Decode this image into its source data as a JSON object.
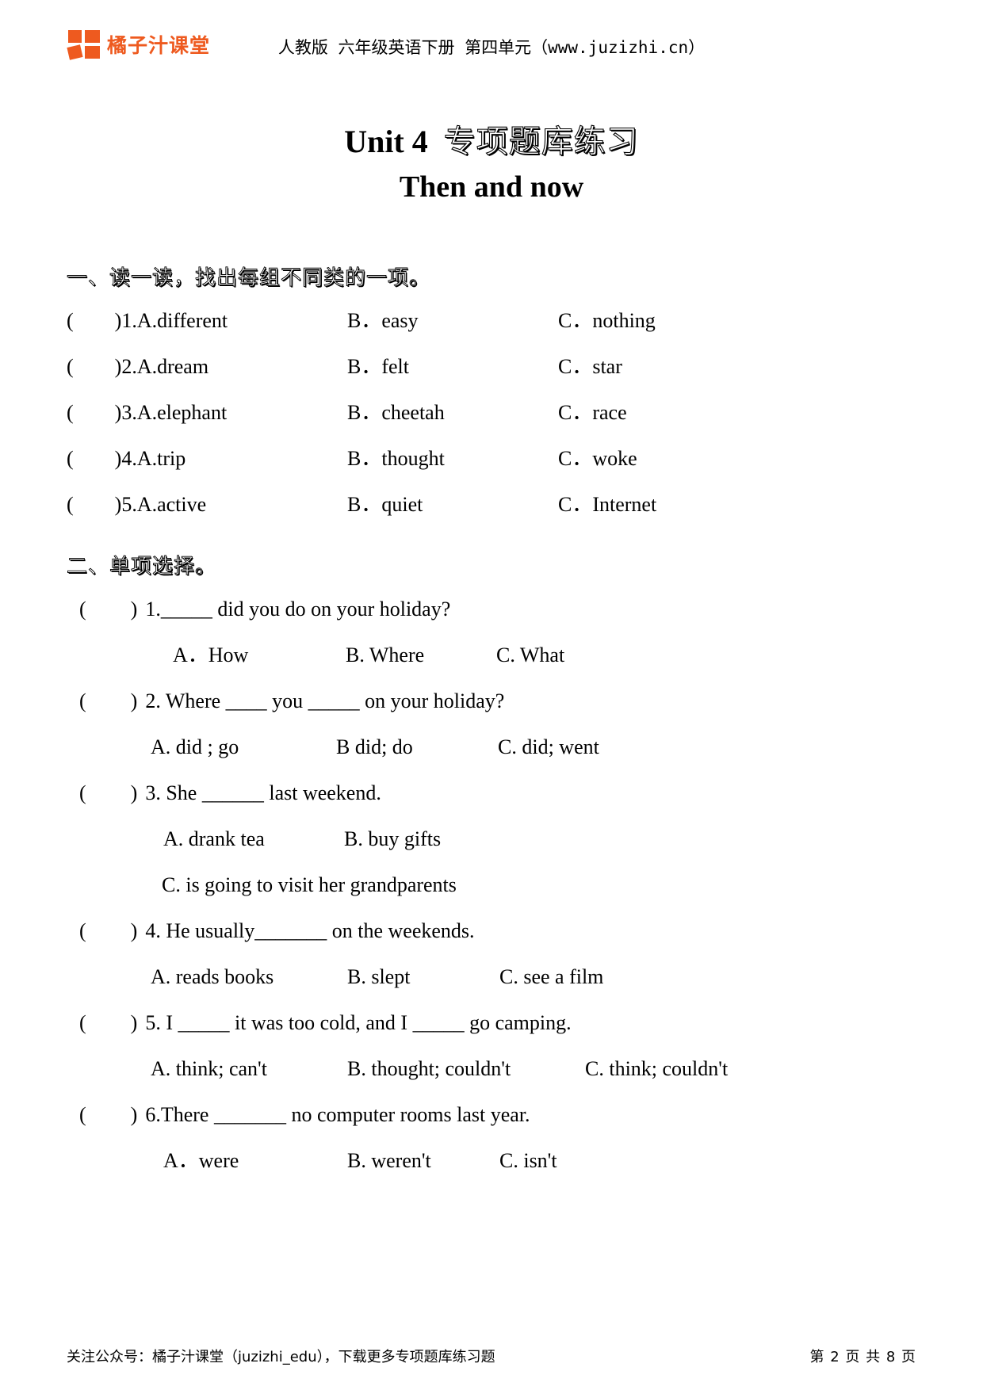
{
  "header": {
    "logo_text": "橘子汁课堂",
    "logo_color": "#EE5A1F",
    "title": "人教版 六年级英语下册 第四单元（www.juzizhi.cn）"
  },
  "title": {
    "line1_en": "Unit 4",
    "line1_cn": "专项题库练习",
    "line2": "Then and now"
  },
  "section1": {
    "heading": "一、读一读，找出每组不同类的一项。",
    "rows": [
      {
        "lead": "(",
        "close": ")1.A.different",
        "b": "B．easy",
        "c": "C．nothing"
      },
      {
        "lead": "(",
        "close": ")2.A.dream",
        "b": "B．felt",
        "c": "C．star"
      },
      {
        "lead": "(",
        "close": ")3.A.elephant",
        "b": "B．cheetah",
        "c": "C．race"
      },
      {
        "lead": "(",
        "close": ")4.A.trip",
        "b": "B．thought",
        "c": "C．woke"
      },
      {
        "lead": "(",
        "close": ")5.A.active",
        "b": "B．quiet",
        "c": "C．Internet"
      }
    ]
  },
  "section2": {
    "heading": "二、单项选择。",
    "questions": [
      {
        "lead": "(",
        "close": ")",
        "stem": "1._____ did you do on your holiday?",
        "options": [
          "A．How",
          "B. Where",
          "C. What"
        ]
      },
      {
        "lead": "(",
        "close": ")",
        "stem": "2. Where ____ you _____ on your holiday?",
        "options": [
          "A. did ; go",
          "B did; do",
          "C. did; went"
        ]
      },
      {
        "lead": "(",
        "close": ")",
        "stem": "3. She ______ last weekend.",
        "options": [
          "A. drank tea",
          "B. buy gifts"
        ],
        "options_line2": [
          "C. is going to visit her grandparents"
        ]
      },
      {
        "lead": "(",
        "close": ")",
        "stem": "4. He usually_______ on the weekends.",
        "options": [
          "A. reads books",
          "B. slept",
          "C. see a film"
        ]
      },
      {
        "lead": "(",
        "close": ")",
        "stem": "5. I _____ it was too cold, and I _____ go camping.",
        "options": [
          "A. think; can't",
          "B. thought; couldn't",
          "C. think; couldn't"
        ]
      },
      {
        "lead": "(",
        "close": ")",
        "stem": "6.There _______ no computer rooms last year.",
        "options": [
          "A．were",
          "B. weren't",
          "C. isn't"
        ]
      }
    ]
  },
  "footer": {
    "left": "关注公众号：橘子汁课堂（juzizhi_edu），下载更多专项题库练习题",
    "right": "第 2 页 共 8 页"
  }
}
